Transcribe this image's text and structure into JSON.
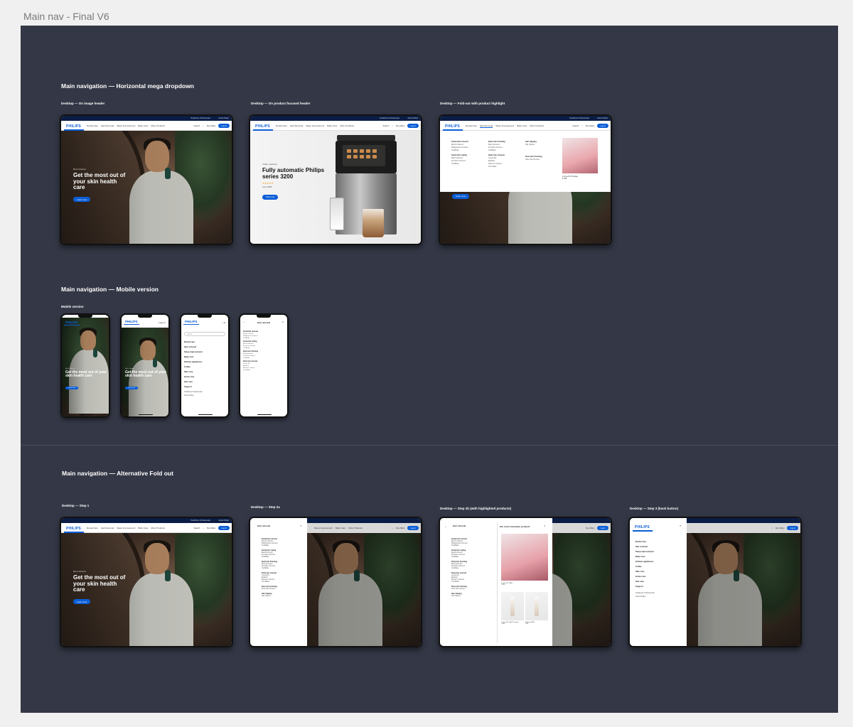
{
  "page": {
    "title": "Main nav - Final V6"
  },
  "sections": {
    "mega": "Main navigation — Horizontal mega dropdown",
    "mobile": "Main navigation — Mobile version",
    "alt": "Main navigation — Alternative Fold out"
  },
  "frame_labels": {
    "d1": "Desktop — On image header",
    "d2": "Desktop — On product focused header",
    "d3": "Desktop — Fold-out with product highlight",
    "mob": "Mobile version",
    "a1": "Desktop — Step 1",
    "a2": "Desktop — Step 2a",
    "a3": "Desktop — Step 2b (with highlighted products)",
    "a4": "Desktop — Step 3 (back button)"
  },
  "header": {
    "logo": "PHILIPS",
    "top_links": [
      "Healthcare Professionals",
      "About Philips"
    ],
    "nav": [
      "Dental Care",
      "Hair Removal",
      "Sleep Improvement",
      "Baby Care",
      "More Products"
    ],
    "search": "Search",
    "account": "My philips",
    "login": "Log in"
  },
  "hero": {
    "eyebrow": "Men's shavers",
    "headline": "Get the most out of your skin health care",
    "cta": "Learn more"
  },
  "product_hero": {
    "eyebrow": "Coffee machines",
    "headline": "Fully automatic Philips series 3200",
    "stars": "★★★★★",
    "price": "From €399",
    "cta": "Shop now"
  },
  "mega_menu": {
    "columns": [
      {
        "groups": [
          {
            "title": "Facial hair removal",
            "items": [
              "Electric shavers",
              "Multipurpose trimmers",
              "OneBlade"
            ]
          },
          {
            "title": "Facial hair styling",
            "items": [
              "Beard trimmers",
              "Precision trimmers",
              "OneBlade"
            ]
          }
        ]
      },
      {
        "groups": [
          {
            "title": "Body hair trimming",
            "items": [
              "Body groomers",
              "Precision trimmers",
              "OneBlade"
            ]
          },
          {
            "title": "Body hair removal",
            "items": [
              "Lumea IPL",
              "Epilators",
              "Women's shavers",
              "Trim Blade"
            ]
          }
        ]
      },
      {
        "groups": [
          {
            "title": "Hair clipping",
            "items": [
              "Hair clippers"
            ]
          },
          {
            "title": "Nose hair trimming",
            "items": [
              "Nose hair trimmers"
            ]
          }
        ]
      }
    ],
    "highlight_caption": "Lumea IPL Prestige",
    "highlight_price": "€ 499"
  },
  "side_panel": {
    "title": "Hair removal",
    "close": "×",
    "back": "←",
    "groups": [
      {
        "title": "Facial hair removal",
        "items": [
          "Electric shavers",
          "Multipurpose trimmers",
          "OneBlade"
        ]
      },
      {
        "title": "Facial hair styling",
        "items": [
          "Beard trimmers",
          "Precision trimmers",
          "OneBlade"
        ]
      },
      {
        "title": "Body hair trimming",
        "items": [
          "Body groomers",
          "Precision trimmers",
          "OneBlade"
        ]
      },
      {
        "title": "Body hair removal",
        "items": [
          "Lumea IPL",
          "Epilators",
          "Women's shavers",
          "Trim Blade"
        ]
      },
      {
        "title": "Nose hair trimming",
        "items": [
          "Nose hair trimmers"
        ]
      },
      {
        "title": "Hair clipping",
        "items": [
          "Hair clippers"
        ]
      }
    ],
    "products_title": "Our most innovative products",
    "products": [
      {
        "name": "Lumea IPL 9000",
        "price": "€ 499"
      },
      {
        "name": "Lumea IPL 8000 Prestige",
        "price": "€ 449"
      },
      {
        "name": "Epilator 8000",
        "price": "€ 89"
      }
    ]
  },
  "main_menu": {
    "items": [
      "Dental care",
      "Hair removal",
      "Sleep improvement",
      "Baby care",
      "Kitchen appliances",
      "Coffee",
      "Skin care",
      "Home care",
      "Hair care",
      "Support"
    ],
    "secondary": [
      "Healthcare Professionals",
      "About Philips"
    ]
  },
  "mobile": {
    "search_placeholder": "Search",
    "icons": "⌕ ☰",
    "icons_login": "Login ≡",
    "home_indicator": ""
  }
}
